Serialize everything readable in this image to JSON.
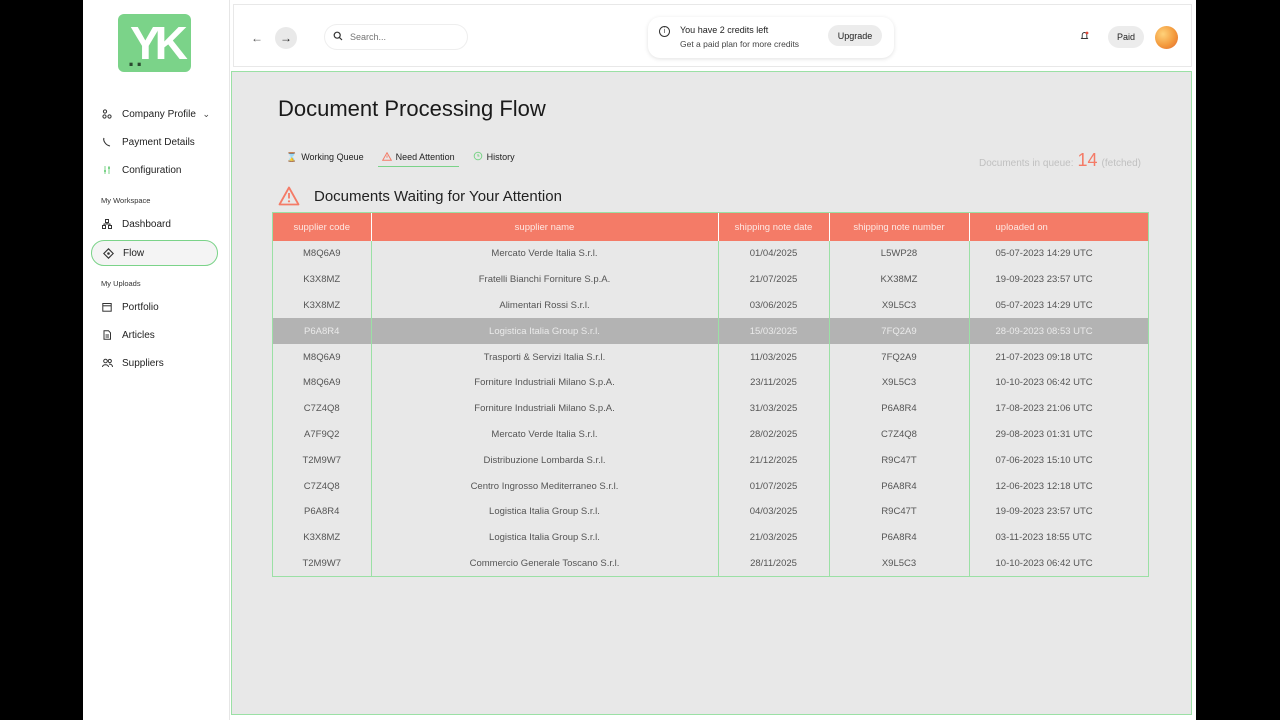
{
  "sidebar": {
    "logo_text": "YK",
    "items_top": [
      {
        "label": "Company Profile",
        "icon": "org-icon"
      },
      {
        "label": "Payment Details",
        "icon": "phone-icon"
      },
      {
        "label": "Configuration",
        "icon": "sliders-icon"
      }
    ],
    "section_workspace": "My Workspace",
    "items_workspace": [
      {
        "label": "Dashboard",
        "icon": "hierarchy-icon"
      },
      {
        "label": "Flow",
        "icon": "flow-icon",
        "active": true
      }
    ],
    "section_uploads": "My Uploads",
    "items_uploads": [
      {
        "label": "Portfolio",
        "icon": "calendar-icon"
      },
      {
        "label": "Articles",
        "icon": "document-icon"
      },
      {
        "label": "Suppliers",
        "icon": "users-icon"
      }
    ]
  },
  "topbar": {
    "search_placeholder": "Search...",
    "credits_line1": "You have 2 credits left",
    "credits_line2": "Get a paid plan for more credits",
    "upgrade_label": "Upgrade",
    "plan_label": "Paid"
  },
  "main": {
    "title": "Document Processing Flow",
    "tabs": [
      {
        "label": "Working Queue"
      },
      {
        "label": "Need Attention",
        "active": true
      },
      {
        "label": "History"
      }
    ],
    "queue_label": "Documents in queue:",
    "queue_count": "14",
    "queue_suffix": "(fetched)",
    "section_title": "Documents Waiting for Your Attention"
  },
  "table": {
    "headers": [
      "supplier code",
      "supplier name",
      "shipping note date",
      "shipping note number",
      "uploaded on"
    ],
    "rows": [
      [
        "M8Q6A9",
        "Mercato Verde Italia S.r.l.",
        "01/04/2025",
        "L5WP28",
        "05-07-2023 14:29 UTC"
      ],
      [
        "K3X8MZ",
        "Fratelli Bianchi Forniture S.p.A.",
        "21/07/2025",
        "KX38MZ",
        "19-09-2023 23:57 UTC"
      ],
      [
        "K3X8MZ",
        "Alimentari Rossi S.r.l.",
        "03/06/2025",
        "X9L5C3",
        "05-07-2023 14:29 UTC"
      ],
      [
        "P6A8R4",
        "Logistica Italia Group S.r.l.",
        "15/03/2025",
        "7FQ2A9",
        "28-09-2023 08:53 UTC"
      ],
      [
        "M8Q6A9",
        "Trasporti & Servizi Italia S.r.l.",
        "11/03/2025",
        "7FQ2A9",
        "21-07-2023 09:18 UTC"
      ],
      [
        "M8Q6A9",
        "Forniture Industriali Milano S.p.A.",
        "23/11/2025",
        "X9L5C3",
        "10-10-2023 06:42 UTC"
      ],
      [
        "C7Z4Q8",
        "Forniture Industriali Milano S.p.A.",
        "31/03/2025",
        "P6A8R4",
        "17-08-2023 21:06 UTC"
      ],
      [
        "A7F9Q2",
        "Mercato Verde Italia S.r.l.",
        "28/02/2025",
        "C7Z4Q8",
        "29-08-2023 01:31 UTC"
      ],
      [
        "T2M9W7",
        "Distribuzione Lombarda S.r.l.",
        "21/12/2025",
        "R9C47T",
        "07-06-2023 15:10 UTC"
      ],
      [
        "C7Z4Q8",
        "Centro Ingrosso Mediterraneo S.r.l.",
        "01/07/2025",
        "P6A8R4",
        "12-06-2023 12:18 UTC"
      ],
      [
        "P6A8R4",
        "Logistica Italia Group S.r.l.",
        "04/03/2025",
        "R9C47T",
        "19-09-2023 23:57 UTC"
      ],
      [
        "K3X8MZ",
        "Logistica Italia Group S.r.l.",
        "21/03/2025",
        "P6A8R4",
        "03-11-2023 18:55 UTC"
      ],
      [
        "T2M9W7",
        "Commercio Generale Toscano S.r.l.",
        "28/11/2025",
        "X9L5C3",
        "10-10-2023 06:42 UTC"
      ]
    ],
    "selected_row": 3
  },
  "colors": {
    "accent_green": "#7bd389",
    "header_coral": "#f47b67",
    "selected_row": "#b3b3b3"
  }
}
